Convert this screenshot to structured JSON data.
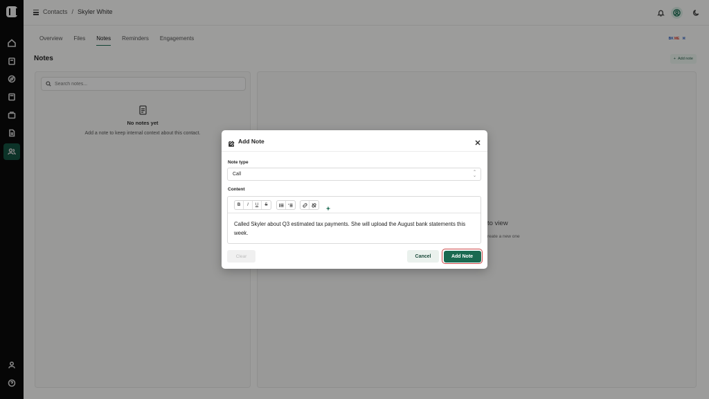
{
  "breadcrumb": {
    "parent": "Contacts",
    "separator": "/",
    "current": "Skyler White"
  },
  "tabs": [
    {
      "label": "Overview"
    },
    {
      "label": "Files"
    },
    {
      "label": "Notes",
      "active": true
    },
    {
      "label": "Reminders"
    },
    {
      "label": "Engagements"
    }
  ],
  "brand": {
    "a": "BK",
    "b": "ME",
    "c": "⌘"
  },
  "notes": {
    "title": "Notes",
    "add_button": "Add note",
    "search_placeholder": "Search notes...",
    "empty_title": "No notes yet",
    "empty_sub": "Add a note to keep internal context about this contact.",
    "right_hint1": "to view",
    "right_hint2": "reate a new one"
  },
  "modal": {
    "title": "Add Note",
    "note_type_label": "Note type",
    "note_type_value": "Call",
    "content_label": "Content",
    "content_text": "Called Skyler about Q3 estimated tax payments. She will upload the August bank statements this week.",
    "toolbar": {
      "bold": "B",
      "italic": "I",
      "underline": "U",
      "strike": "S"
    },
    "clear_button": "Clear",
    "cancel_button": "Cancel",
    "submit_button": "Add Note"
  },
  "colors": {
    "accent": "#1a6a51",
    "rail": "#0a0a0a",
    "focus_ring": "#c94545"
  }
}
